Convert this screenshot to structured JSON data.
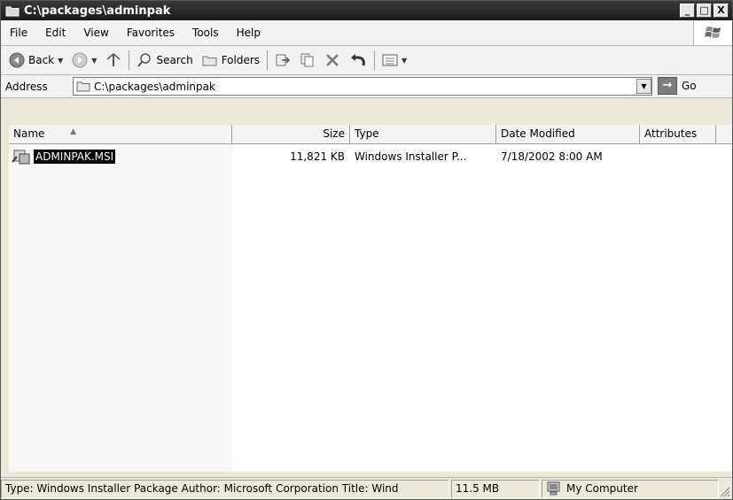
{
  "window": {
    "title": "C:\\packages\\adminpak",
    "minimize_label": "_",
    "maximize_label": "□",
    "close_label": "X"
  },
  "menu": {
    "items": [
      "File",
      "Edit",
      "View",
      "Favorites",
      "Tools",
      "Help"
    ]
  },
  "toolbar": {
    "back_label": "Back",
    "search_label": "Search",
    "folders_label": "Folders"
  },
  "address": {
    "label": "Address",
    "value": "C:\\packages\\adminpak",
    "go_label": "Go"
  },
  "columns": {
    "name": "Name",
    "size": "Size",
    "type": "Type",
    "date": "Date Modified",
    "attributes": "Attributes"
  },
  "files": [
    {
      "name": "ADMINPAK.MSI",
      "size": "11,821 KB",
      "type": "Windows Installer P...",
      "date": "7/18/2002 8:00 AM",
      "attributes": ""
    }
  ],
  "status": {
    "info": "Type: Windows Installer Package Author: Microsoft Corporation Title: Wind",
    "size": "11.5 MB",
    "location": "My Computer"
  },
  "icons": {
    "title": "folder-icon",
    "back": "back-arrow-icon",
    "forward": "forward-arrow-icon",
    "up": "up-folder-icon",
    "search": "search-icon",
    "folders": "folders-icon",
    "move": "move-to-icon",
    "copy": "copy-to-icon",
    "delete": "delete-icon",
    "undo": "undo-icon",
    "views": "views-icon",
    "file": "msi-package-icon",
    "computer": "computer-icon"
  }
}
